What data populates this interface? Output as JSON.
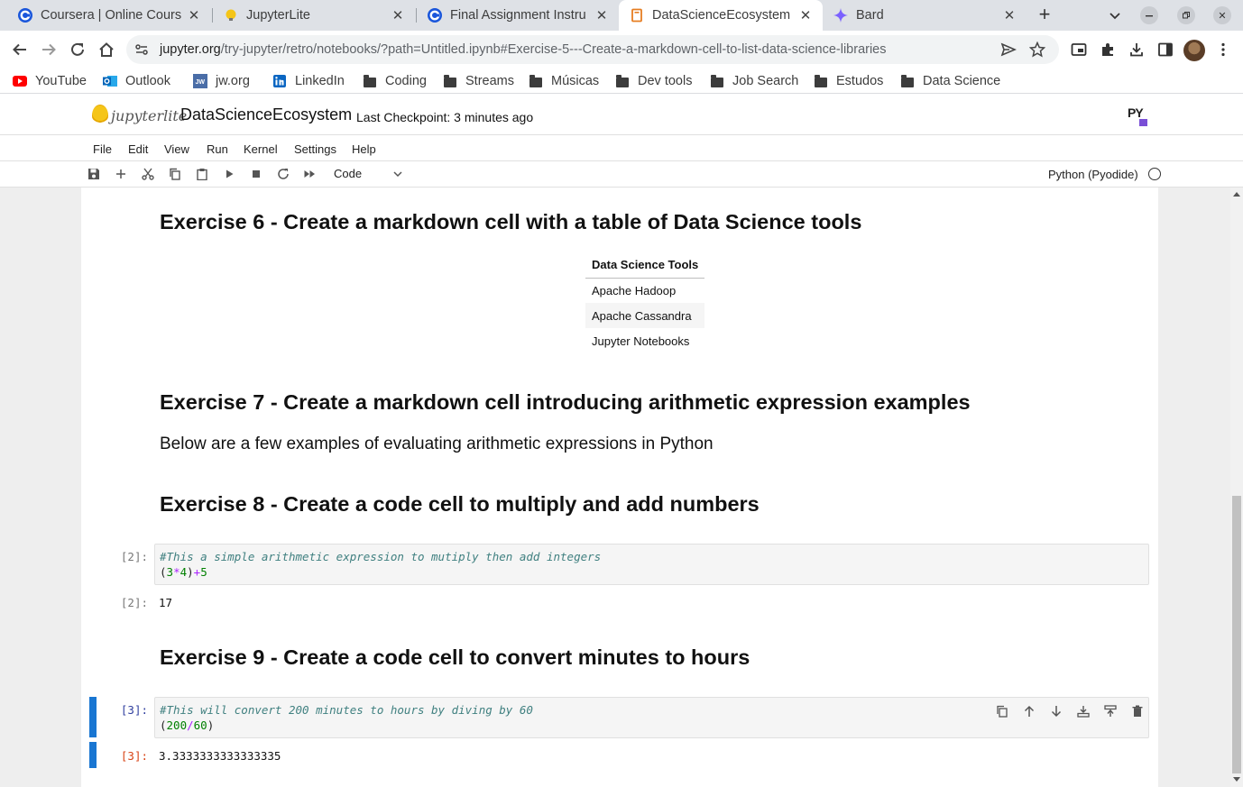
{
  "browser": {
    "tabs": [
      {
        "title": "Coursera | Online Cours",
        "icon": "coursera-icon",
        "active": false
      },
      {
        "title": "JupyterLite",
        "icon": "jupyterlite-icon",
        "active": false
      },
      {
        "title": "Final Assignment Instru",
        "icon": "coursera-icon",
        "active": false
      },
      {
        "title": "DataScienceEcosystem",
        "icon": "notebook-icon",
        "active": true
      },
      {
        "title": "Bard",
        "icon": "bard-icon",
        "active": false
      }
    ],
    "url_domain": "jupyter.org",
    "url_path": "/try-jupyter/retro/notebooks/?path=Untitled.ipynb#Exercise-5---Create-a-markdown-cell-to-list-data-science-libraries",
    "bookmarks": [
      {
        "label": "YouTube",
        "icon": "youtube-icon"
      },
      {
        "label": "Outlook",
        "icon": "outlook-icon"
      },
      {
        "label": "jw.org",
        "icon": "jw-icon"
      },
      {
        "label": "LinkedIn",
        "icon": "linkedin-icon"
      },
      {
        "label": "Coding",
        "icon": "folder-icon"
      },
      {
        "label": "Streams",
        "icon": "folder-icon"
      },
      {
        "label": "Músicas",
        "icon": "folder-icon"
      },
      {
        "label": "Dev tools",
        "icon": "folder-icon"
      },
      {
        "label": "Job Search",
        "icon": "folder-icon"
      },
      {
        "label": "Estudos",
        "icon": "folder-icon"
      },
      {
        "label": "Data Science",
        "icon": "folder-icon"
      }
    ]
  },
  "jupyter": {
    "logo_text": "jupyterlite",
    "notebook_title": "DataScienceEcosystem",
    "checkpoint": "Last Checkpoint: 3 minutes ago",
    "py_badge": "PY",
    "menu": [
      "File",
      "Edit",
      "View",
      "Run",
      "Kernel",
      "Settings",
      "Help"
    ],
    "cell_type": "Code",
    "kernel_name": "Python (Pyodide)"
  },
  "notebook": {
    "ex6_title": "Exercise 6 - Create a markdown cell with a table of Data Science tools",
    "table_header": "Data Science Tools",
    "table_rows": [
      "Apache Hadoop",
      "Apache Cassandra",
      "Jupyter Notebooks"
    ],
    "ex7_title": "Exercise 7 - Create a markdown cell introducing arithmetic expression examples",
    "ex7_text": "Below are a few examples of evaluating arithmetic expressions in Python",
    "ex8_title": "Exercise 8 - Create a code cell to multiply and add numbers",
    "cell2_prompt_in": "[2]:",
    "cell2_comment": "#This a simple arithmetic expression to mutiply then add integers",
    "cell2_code": [
      "(",
      "3",
      "*",
      "4",
      ")",
      "+",
      "5"
    ],
    "cell2_prompt_out": "[2]:",
    "cell2_output": "17",
    "ex9_title": "Exercise 9 - Create a code cell to convert minutes to hours",
    "cell3_prompt_in": "[3]:",
    "cell3_comment": "#This will convert 200 minutes to hours by diving by 60",
    "cell3_code": [
      "(",
      "200",
      "/",
      "60",
      ")"
    ],
    "cell3_prompt_out": "[3]:",
    "cell3_output": "3.3333333333333335"
  },
  "colors": {
    "accent_blue": "#1976d2",
    "chrome_tabstrip": "#dee1e6",
    "comment_green": "#408080",
    "number_green": "#008000",
    "operator_purple": "#aa22ff",
    "out_prompt_red": "#d84315"
  }
}
